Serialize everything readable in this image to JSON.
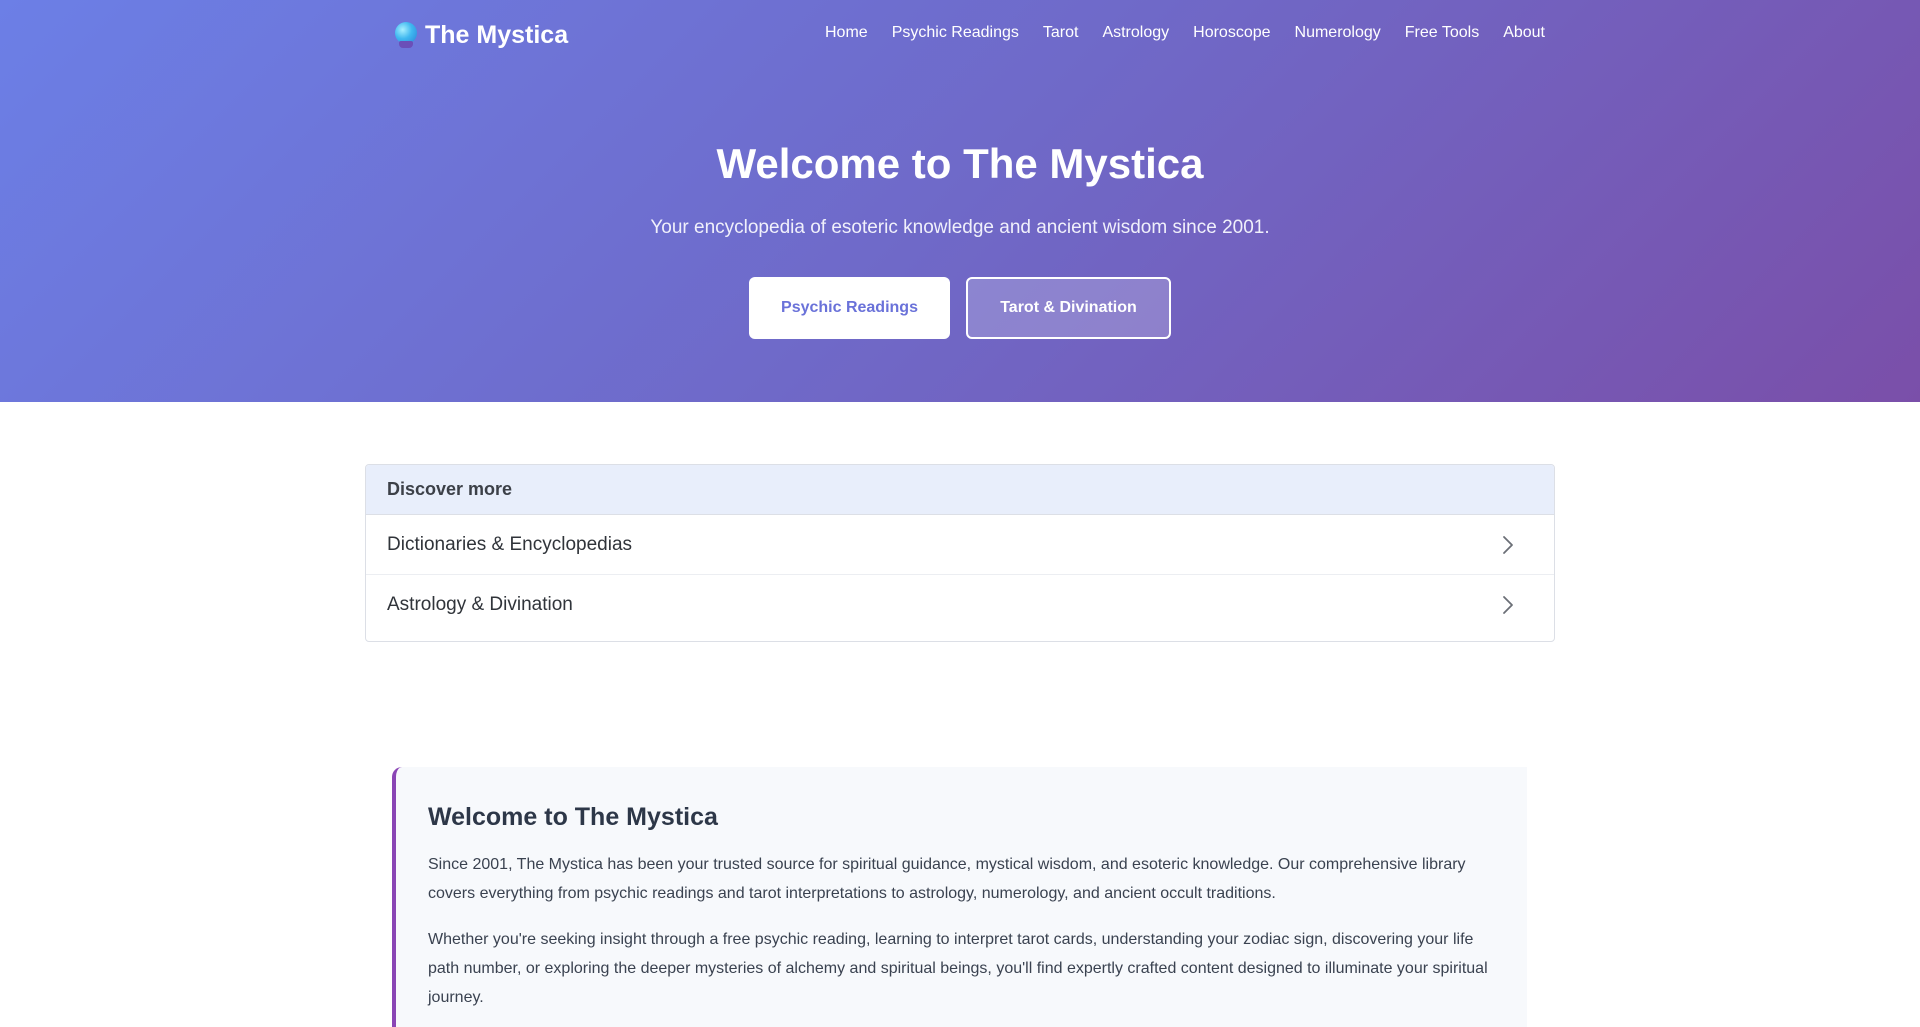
{
  "nav": {
    "brand": "The Mystica",
    "links": [
      "Home",
      "Psychic Readings",
      "Tarot",
      "Astrology",
      "Horoscope",
      "Numerology",
      "Free Tools",
      "About"
    ]
  },
  "hero": {
    "title": "Welcome to The Mystica",
    "subtitle": "Your encyclopedia of esoteric knowledge and ancient wisdom since 2001.",
    "primary_button": "Psychic Readings",
    "secondary_button": "Tarot & Divination"
  },
  "discover": {
    "heading": "Discover more",
    "items": [
      "Dictionaries & Encyclopedias",
      "Astrology & Divination"
    ]
  },
  "welcome": {
    "heading": "Welcome to The Mystica",
    "paragraph1": "Since 2001, The Mystica has been your trusted source for spiritual guidance, mystical wisdom, and esoteric knowledge. Our comprehensive library covers everything from psychic readings and tarot interpretations to astrology, numerology, and ancient occult traditions.",
    "paragraph2": "Whether you're seeking insight through a free psychic reading, learning to interpret tarot cards, understanding your zodiac sign, discovering your life path number, or exploring the deeper mysteries of alchemy and spiritual beings, you'll find expertly crafted content designed to illuminate your spiritual journey."
  },
  "colors": {
    "hero_gradient_start": "#6c7fe6",
    "hero_gradient_end": "#7a4fa9",
    "accent_border": "#8a45b5",
    "button_text": "#6a72d9"
  },
  "icons": {
    "logo": "crystal-ball-icon",
    "row_arrow": "chevron-right-icon"
  }
}
